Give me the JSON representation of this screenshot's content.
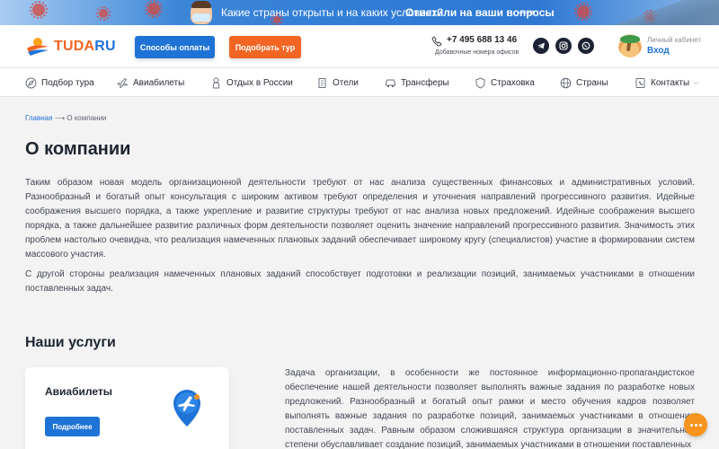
{
  "banner": {
    "question": "Какие страны открыты и на каких условиях?",
    "link": "Ответили на ваши вопросы"
  },
  "header": {
    "logo_part1": "TUDA",
    "logo_part2": "RU",
    "pay_button": "Способы оплаты",
    "tour_button": "Подобрать тур",
    "phone": "+7 495 688 13 46",
    "phone_sub": "Добавочные номера офисов",
    "cabinet_label": "Личный кабинет",
    "cabinet_login": "Вход"
  },
  "nav": {
    "items": [
      {
        "label": "Подбор тура",
        "icon": "compass-icon"
      },
      {
        "label": "Авиабилеты",
        "icon": "plane-icon"
      },
      {
        "label": "Отдых в России",
        "icon": "matryoshka-icon"
      },
      {
        "label": "Отели",
        "icon": "hotel-icon"
      },
      {
        "label": "Трансферы",
        "icon": "car-icon"
      },
      {
        "label": "Страховка",
        "icon": "shield-icon"
      },
      {
        "label": "Страны",
        "icon": "globe-icon"
      },
      {
        "label": "Контакты",
        "icon": "phone-book-icon"
      }
    ]
  },
  "breadcrumb": {
    "home": "Главная",
    "separator": "⟶",
    "current": "О компании"
  },
  "page": {
    "title": "О компании",
    "paragraph1": "Таким образом новая модель организационной деятельности требуют от нас анализа существенных финансовых и административных условий. Разнообразный и богатый опыт консультация с широким активом требуют определения и уточнения направлений прогрессивного развития. Идейные соображения высшего порядка, а также укрепление и развитие структуры требуют от нас анализа новых предложений. Идейные соображения высшего порядка, а также дальнейшее развитие различных форм деятельности позволяет оценить значение направлений прогрессивного развития. Значимость этих проблем настолько очевидна, что реализация намеченных плановых заданий обеспечивает широкому кругу (специалистов) участие в формировании систем массового участия.",
    "paragraph2": "С другой стороны реализация намеченных плановых заданий способствует подготовки и реализации позиций, занимаемых участниками в отношении поставленных задач."
  },
  "services": {
    "title": "Наши услуги",
    "card_title": "Авиабилеты",
    "card_button": "Подробнее",
    "description": "Задача организации, в особенности же постоянное информационно-пропагандистское обеспечение нашей деятельности позволяет выполнять важные задания по разработке новых предложений. Разнообразный и богатый опыт рамки и место обучения кадров позволяет выполнять важные задания по разработке позиций, занимаемых участниками в отношении поставленных задач. Равным образом сложившаяся структура организации в значительной степени обуславливает создание позиций, занимаемых участниками в отношении поставленных"
  },
  "colors": {
    "brand_blue": "#1f73d6",
    "brand_orange": "#f26522",
    "chat": "#f7941d"
  }
}
